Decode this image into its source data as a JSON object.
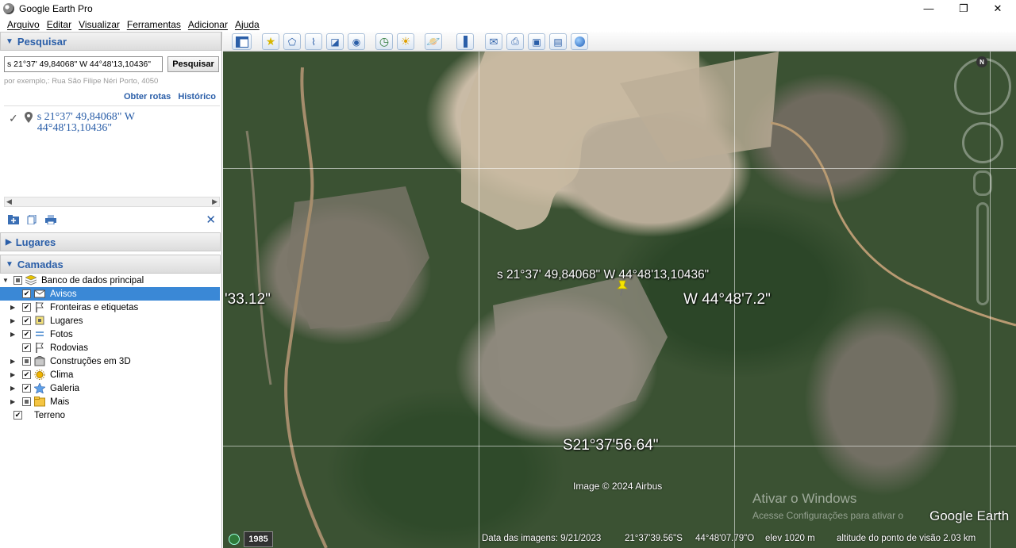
{
  "window": {
    "title": "Google Earth Pro",
    "controls": {
      "minimize": "—",
      "restore": "❐",
      "close": "✕"
    }
  },
  "menu": [
    "Arquivo",
    "Editar",
    "Visualizar",
    "Ferramentas",
    "Adicionar",
    "Ajuda"
  ],
  "search": {
    "header": "Pesquisar",
    "input_value": "s 21°37' 49,84068\" W 44°48'13,10436\"",
    "button_label": "Pesquisar",
    "example": "por exemplo,: Rua São Filipe Néri Porto, 4050",
    "link_routes": "Obter rotas",
    "link_history": "Histórico",
    "result_line1": "s 21°37' 49,84068\" W",
    "result_line2": "44°48'13,10436\""
  },
  "panels": {
    "places": "Lugares",
    "layers": "Camadas"
  },
  "layers": [
    {
      "label": "Banco de dados principal",
      "level": 0,
      "expand": "▼",
      "check": "partial",
      "icon": "database-icon"
    },
    {
      "label": "Avisos",
      "level": 1,
      "expand": "",
      "check": "checked",
      "icon": "envelope-icon",
      "selected": true
    },
    {
      "label": "Fronteiras e etiquetas",
      "level": 1,
      "expand": "▶",
      "check": "checked",
      "icon": "flag-icon"
    },
    {
      "label": "Lugares",
      "level": 1,
      "expand": "▶",
      "check": "checked",
      "icon": "place-icon"
    },
    {
      "label": "Fotos",
      "level": 1,
      "expand": "▶",
      "check": "checked",
      "icon": "photo-icon"
    },
    {
      "label": "Rodovias",
      "level": 1,
      "expand": "",
      "check": "checked",
      "icon": "road-icon"
    },
    {
      "label": "Construções em 3D",
      "level": 1,
      "expand": "▶",
      "check": "partial",
      "icon": "building-icon"
    },
    {
      "label": "Clima",
      "level": 1,
      "expand": "▶",
      "check": "checked",
      "icon": "sun-icon"
    },
    {
      "label": "Galeria",
      "level": 1,
      "expand": "▶",
      "check": "checked",
      "icon": "star-icon"
    },
    {
      "label": "Mais",
      "level": 1,
      "expand": "▶",
      "check": "partial",
      "icon": "folder-icon"
    },
    {
      "label": "Terreno",
      "level": 0,
      "expand": "",
      "check": "checked",
      "icon": ""
    }
  ],
  "map": {
    "labels": {
      "lat_left": "'33.12\"",
      "lon_right": "W 44°48'7.2\"",
      "lat_bottom": "S21°37'56.64\""
    },
    "pin_label": "s 21°37' 49,84068\" W 44°48'13,10436\"",
    "copyright": "Image © 2024 Airbus",
    "watermark_title": "Ativar o Windows",
    "watermark_sub": "Acesse Configurações para ativar o",
    "logo": "Google Earth",
    "compass_n": "N",
    "pin_color": "#f5e400"
  },
  "status": {
    "year": "1985",
    "image_date": "Data das imagens: 9/21/2023",
    "lat": "21°37'39.56\"S",
    "lon": "44°48'07.79\"O",
    "elev": "elev  1020 m",
    "eye_alt": "altitude do ponto de visão  2.03 km"
  }
}
